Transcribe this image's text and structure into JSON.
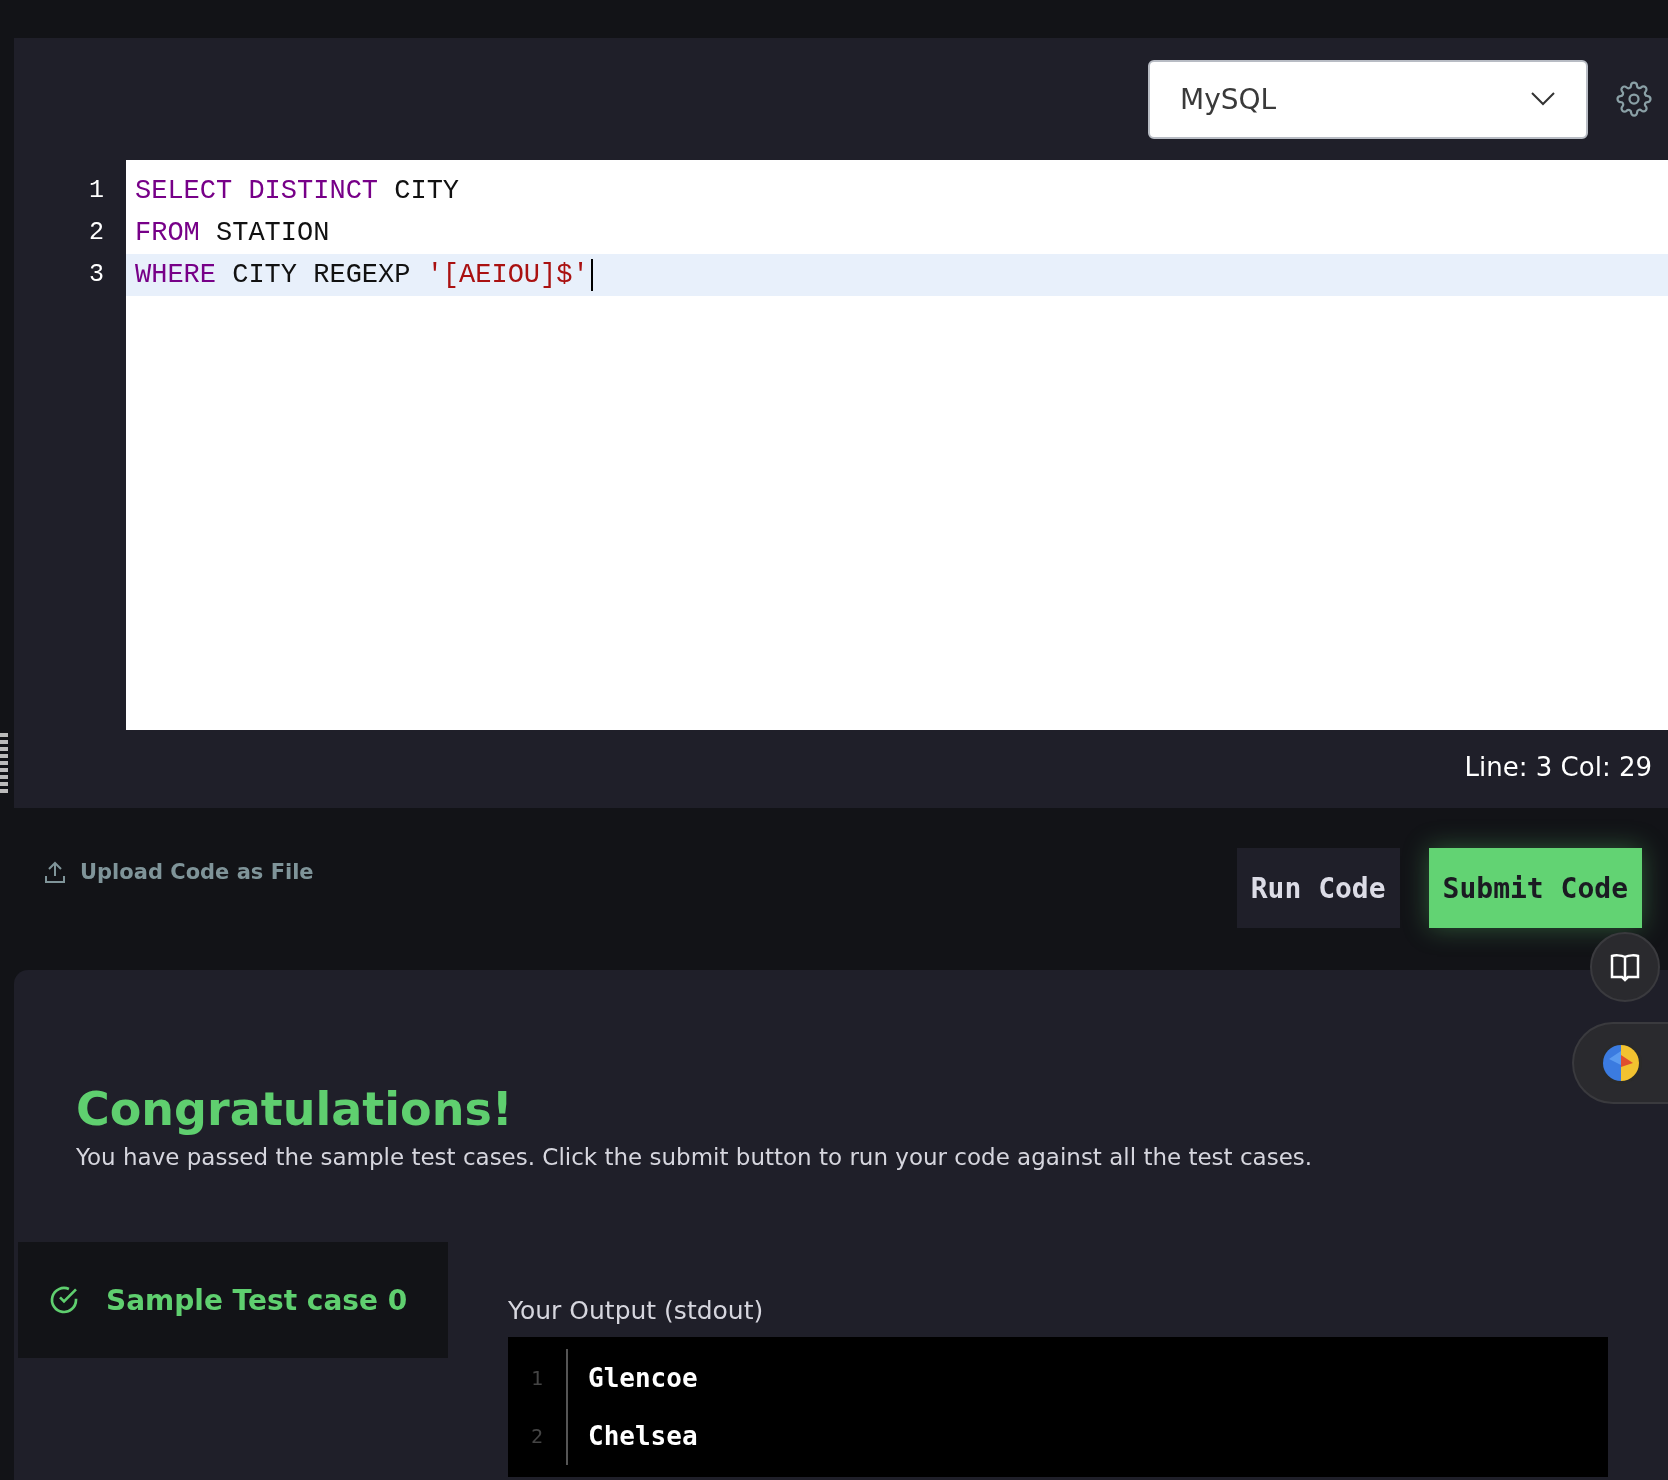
{
  "language_select": {
    "value": "MySQL"
  },
  "editor": {
    "lines": [
      {
        "number": "1",
        "current": false,
        "cursor": false,
        "tokens": [
          {
            "text": "SELECT DISTINCT",
            "kind": "keyword"
          },
          {
            "text": "CITY",
            "kind": "plain"
          }
        ]
      },
      {
        "number": "2",
        "current": false,
        "cursor": false,
        "tokens": [
          {
            "text": "FROM",
            "kind": "keyword"
          },
          {
            "text": "STATION",
            "kind": "plain"
          }
        ]
      },
      {
        "number": "3",
        "current": true,
        "cursor": true,
        "tokens": [
          {
            "text": "WHERE",
            "kind": "keyword"
          },
          {
            "text": "CITY REGEXP",
            "kind": "plain"
          },
          {
            "text": "'[AEIOU]$'",
            "kind": "string"
          }
        ]
      }
    ],
    "status": "Line: 3 Col: 29"
  },
  "upload_link": "Upload Code as File",
  "buttons": [
    {
      "label": "Run Code",
      "kind": "secondary"
    },
    {
      "label": "Submit Code",
      "kind": "primary"
    }
  ],
  "result": {
    "title": "Congratulations!",
    "message": "You have passed the sample test cases. Click the submit button to run your code against all the test cases."
  },
  "test_cases": [
    {
      "label": "Sample Test case 0",
      "passed": true,
      "selected": true
    }
  ],
  "output": {
    "label": "Your Output (stdout)",
    "lines": [
      {
        "number": "1",
        "text": "Glencoe"
      },
      {
        "number": "2",
        "text": "Chelsea"
      }
    ]
  }
}
